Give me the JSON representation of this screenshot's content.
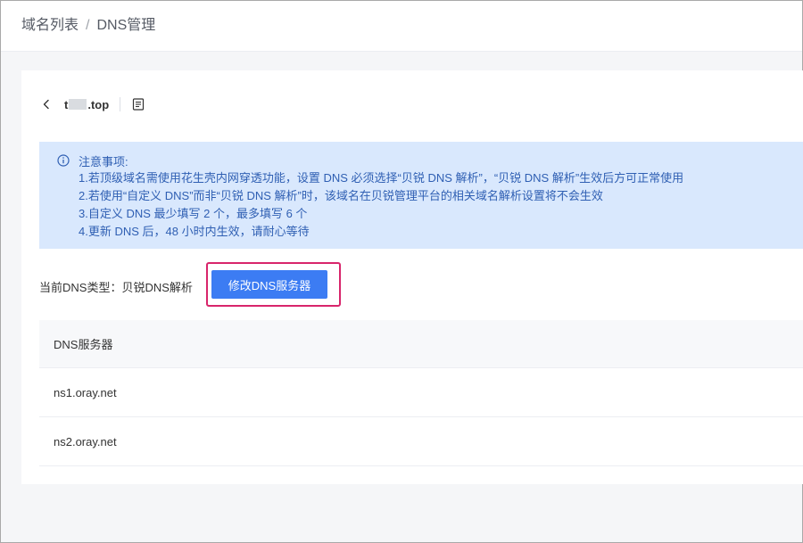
{
  "breadcrumb": {
    "parent": "域名列表",
    "separator": "/",
    "current": "DNS管理"
  },
  "domain": {
    "prefix": "t",
    "suffix": ".top",
    "back_icon": "chevron-left-icon",
    "doc_icon": "document-icon"
  },
  "notice": {
    "icon": "info-icon",
    "title": "注意事项:",
    "lines": [
      "1.若顶级域名需使用花生壳内网穿透功能，设置 DNS 必须选择“贝锐 DNS 解析”，“贝锐 DNS 解析”生效后方可正常使用",
      "2.若使用“自定义 DNS”而非“贝锐 DNS 解析”时，该域名在贝锐管理平台的相关域名解析设置将不会生效",
      "3.自定义 DNS 最少填写 2 个，最多填写 6 个",
      "4.更新 DNS 后，48 小时内生效，请耐心等待"
    ]
  },
  "dns_type": {
    "label": "当前DNS类型：",
    "value": "贝锐DNS解析",
    "button_label": "修改DNS服务器"
  },
  "table": {
    "header": "DNS服务器",
    "rows": [
      "ns1.oray.net",
      "ns2.oray.net"
    ]
  },
  "colors": {
    "primary": "#3c7cf3",
    "notice_bg": "#d9e8fd",
    "notice_text": "#2f5fb3",
    "highlight": "#d8256b"
  }
}
